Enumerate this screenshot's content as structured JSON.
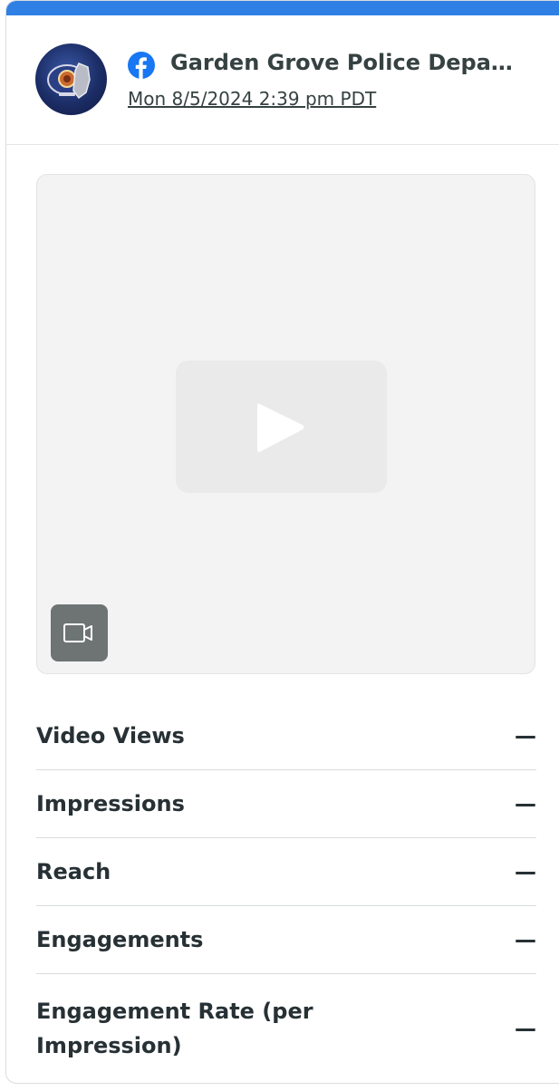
{
  "post": {
    "network_icon": "facebook-icon",
    "author": "Garden Grove Police Depa…",
    "timestamp": "Mon 8/5/2024 2:39 pm PDT",
    "media_type_icon": "video-camera-icon",
    "media_placeholder_icon": "play-icon"
  },
  "metrics": [
    {
      "label": "Video Views",
      "value": "—"
    },
    {
      "label": "Impressions",
      "value": "—"
    },
    {
      "label": "Reach",
      "value": "—"
    },
    {
      "label": "Engagements",
      "value": "—"
    },
    {
      "label": "Engagement Rate (per Impression)",
      "value": "—"
    }
  ],
  "colors": {
    "accent_bar": "#2f80e5",
    "facebook_blue": "#1877f2",
    "text": "#273135"
  }
}
